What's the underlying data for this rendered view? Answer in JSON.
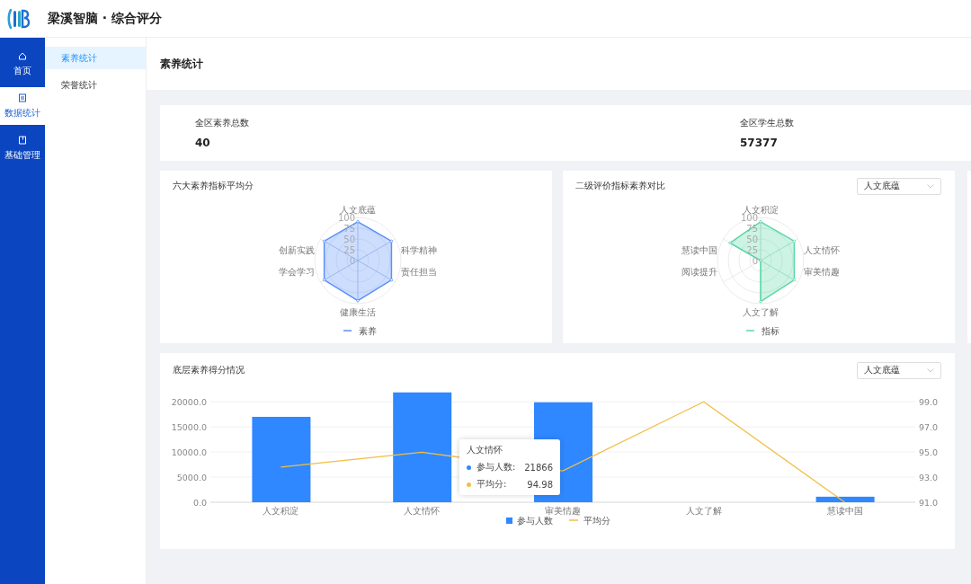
{
  "header": {
    "title": "梁溪智脑 · 综合评分"
  },
  "nav": [
    {
      "label": "首页",
      "selected": false
    },
    {
      "label": "数据统计",
      "selected": true
    },
    {
      "label": "基础管理",
      "selected": false
    }
  ],
  "submenu": [
    {
      "label": "素养统计",
      "selected": true
    },
    {
      "label": "荣誉统计",
      "selected": false
    }
  ],
  "page_title": "素养统计",
  "stats": [
    {
      "label": "全区素养总数",
      "value": "40"
    },
    {
      "label": "全区学生总数",
      "value": "57377"
    }
  ],
  "radar_cards": [
    {
      "title": "六大素养指标平均分",
      "ticks": [
        "100",
        "75",
        "50",
        "25",
        "0"
      ],
      "legend": "素养",
      "color": "#5b8ff9",
      "axes": [
        {
          "label": "人文底蕴",
          "level": 0.9
        },
        {
          "label": "科学精神",
          "level": 0.9
        },
        {
          "label": "责任担当",
          "level": 0.9
        },
        {
          "label": "健康生活",
          "level": 0.93
        },
        {
          "label": "学会学习",
          "level": 0.9
        },
        {
          "label": "创新实践",
          "level": 0.9
        }
      ]
    },
    {
      "title": "二级评价指标素养对比",
      "dropdown": "人文底蕴",
      "ticks": [
        "100",
        "75",
        "50",
        "25",
        "0"
      ],
      "legend": "指标",
      "color": "#5ad8a6",
      "axes": [
        {
          "label": "人文积淀",
          "level": 0.9
        },
        {
          "label": "人文情怀",
          "level": 0.9
        },
        {
          "label": "审美情趣",
          "level": 0.9
        },
        {
          "label": "人文了解",
          "level": 0.95
        },
        {
          "label": "阅读提升",
          "level": 0
        },
        {
          "label": "慧读中国",
          "level": 0.82
        }
      ]
    }
  ],
  "score_chart": {
    "title": "底层素养得分情况",
    "dropdown": "人文底蕴",
    "chart_data": {
      "type": "bar",
      "categories": [
        "人文积淀",
        "人文情怀",
        "审美情趣",
        "人文了解",
        "慧读中国"
      ],
      "series": [
        {
          "name": "参与人数",
          "color": "#2f88ff",
          "values": [
            17000,
            21866,
            19900,
            0,
            1100
          ]
        },
        {
          "name": "平均分",
          "color": "#f0bf45",
          "type": "line",
          "axis": "y2",
          "values": [
            93.8,
            94.98,
            93.5,
            99.0,
            91.0
          ]
        }
      ],
      "grid": true,
      "legend": "bottom",
      "ylim": [
        0,
        22000
      ],
      "yticks": [
        {
          "value": 0,
          "label": "0.0"
        },
        {
          "value": 5000,
          "label": "5000.0"
        },
        {
          "value": 10000,
          "label": "10000.0"
        },
        {
          "value": 15000,
          "label": "15000.0"
        },
        {
          "value": 20000,
          "label": "20000.0"
        }
      ],
      "y2lim": [
        91,
        99
      ],
      "y2ticks": [
        {
          "value": 91,
          "label": "91.0"
        },
        {
          "value": 93,
          "label": "93.0"
        },
        {
          "value": 95,
          "label": "95.0"
        },
        {
          "value": 97,
          "label": "97.0"
        },
        {
          "value": 99,
          "label": "99.0"
        }
      ]
    },
    "tooltip": {
      "title": "人文情怀",
      "rows": [
        {
          "label": "参与人数:",
          "value": "21866",
          "color": "#2f88ff"
        },
        {
          "label": "平均分:",
          "value": "94.98",
          "color": "#f0bf45"
        }
      ]
    }
  }
}
